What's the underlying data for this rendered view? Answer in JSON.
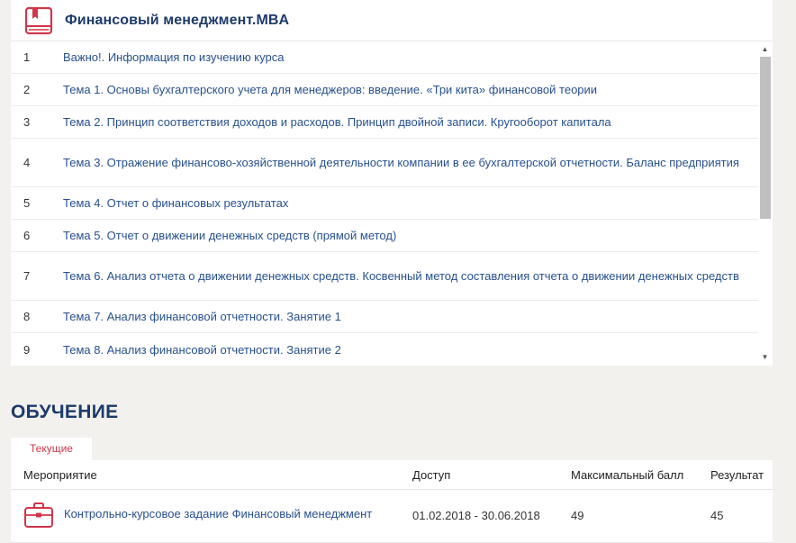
{
  "course": {
    "title": "Финансовый менеджмент.MBA",
    "lessons": [
      {
        "num": "1",
        "title": "Важно!. Информация по изучению курса"
      },
      {
        "num": "2",
        "title": "Тема 1. Основы бухгалтерского учета для менеджеров: введение. «Три кита» финансовой теории"
      },
      {
        "num": "3",
        "title": "Тема 2. Принцип соответствия доходов и расходов. Принцип двойной записи. Кругооборот капитала"
      },
      {
        "num": "4",
        "title": "Тема 3. Отражение финансово-хозяйственной деятельности компании в ее бухгалтерской отчетности. Баланс предприятия"
      },
      {
        "num": "5",
        "title": "Тема 4. Отчет о финансовых результатах"
      },
      {
        "num": "6",
        "title": "Тема 5. Отчет о движении денежных средств (прямой метод)"
      },
      {
        "num": "7",
        "title": "Тема 6. Анализ отчета о движении денежных средств. Косвенный метод составления отчета о движении денежных средств"
      },
      {
        "num": "8",
        "title": "Тема 7. Анализ финансовой отчетности. Занятие 1"
      },
      {
        "num": "9",
        "title": "Тема 8. Анализ финансовой отчетности. Занятие 2"
      }
    ]
  },
  "learning": {
    "title": "ОБУЧЕНИЕ",
    "tab_current": "Текущие",
    "columns": {
      "event": "Мероприятие",
      "access": "Доступ",
      "max_score": "Максимальный балл",
      "result": "Результат"
    },
    "rows": [
      {
        "event": "Контрольно-курсовое задание Финансовый менеджмент",
        "access": "01.02.2018 - 30.06.2018",
        "max_score": "49",
        "result": "45"
      }
    ]
  },
  "icons": {
    "course": "book-icon",
    "event": "briefcase-icon"
  },
  "colors": {
    "accent": "#d0364b",
    "link": "#27508e",
    "heading": "#1d3a6b",
    "background": "#f2f1ee"
  }
}
